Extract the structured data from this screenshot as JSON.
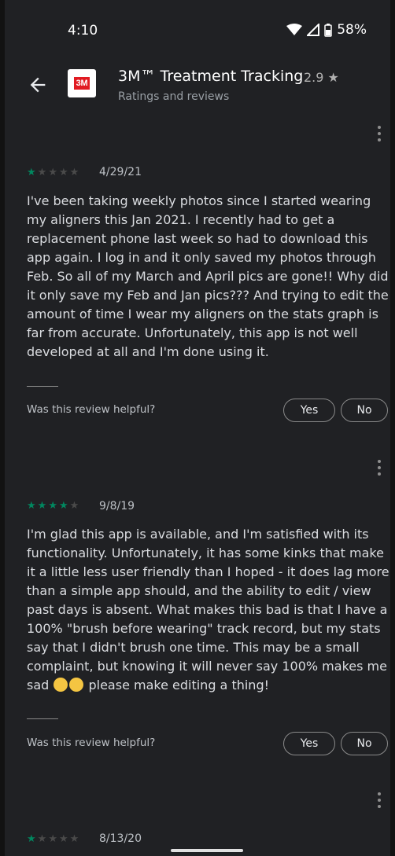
{
  "status": {
    "time": "4:10",
    "battery": "58%"
  },
  "header": {
    "app_logo_text": "3M",
    "app_title": "3M™ Treatment Tracking",
    "rating": "2.9 ★",
    "subtitle": "Ratings and reviews"
  },
  "reviews": [
    {
      "stars": 1,
      "date": "4/29/21",
      "text": "I've been taking weekly photos since I started wearing my aligners this Jan 2021. I recently had to get a replacement phone last week so had to download this app again. I log in and it only saved my photos through Feb. So all of my March and April pics are gone!! Why did it only save my Feb and Jan pics??? And trying to edit the amount of time I wear my aligners on the stats graph is far from accurate. Unfortunately, this app is not well developed at all and I'm done using it.",
      "helpful_prompt": "Was this review helpful?",
      "yes_label": "Yes",
      "no_label": "No"
    },
    {
      "stars": 4,
      "date": "9/8/19",
      "text_before": "I'm glad this app is available, and I'm satisfied with its functionality. Unfortunately, it has some kinks that make it a little less user friendly than I hoped - it does lag more than a simple app should, and the ability to edit / view past days is absent. What makes this bad is that I have a 100% \"brush before wearing\" track record, but my stats say that I didn't brush one time. This may be a small complaint, but knowing it will never say 100% makes me sad",
      "text_after": " please make editing a thing!",
      "helpful_prompt": "Was this review helpful?",
      "yes_label": "Yes",
      "no_label": "No"
    },
    {
      "stars": 1,
      "date": "8/13/20"
    }
  ],
  "icons": {
    "back": "arrow-left-icon",
    "more": "more-vert-icon",
    "wifi": "wifi-icon",
    "signal": "signal-icon",
    "battery": "battery-icon"
  },
  "colors": {
    "star_on": "#01875f",
    "background": "#202124"
  }
}
